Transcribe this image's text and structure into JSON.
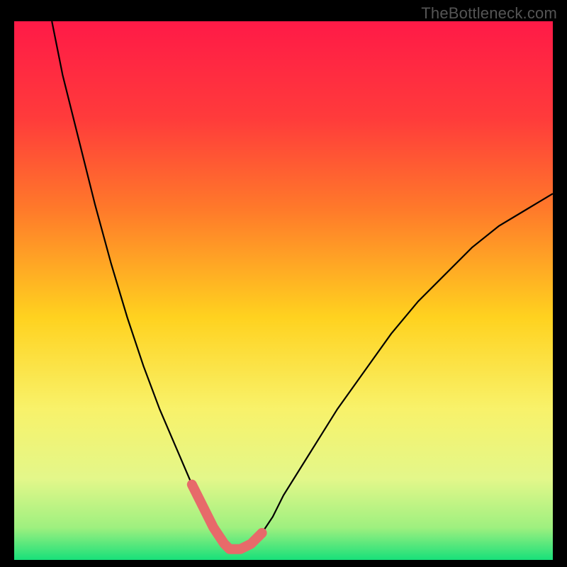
{
  "watermark": "TheBottleneck.com",
  "chart_data": {
    "type": "line",
    "title": "",
    "xlabel": "",
    "ylabel": "",
    "xlim": [
      0,
      100
    ],
    "ylim": [
      0,
      100
    ],
    "grid": false,
    "legend": false,
    "description": "Bottleneck-style V-curve over a red-to-green vertical gradient. Upper region is red (poor match), lower region is green (good match). The curve descends from the top-left, bottoms out near the lower third of the x-range, and rises again toward the right. The curve's trough is highlighted with a thicker salmon stroke.",
    "series": [
      {
        "name": "curve",
        "x": [
          7,
          9,
          12,
          15,
          18,
          21,
          24,
          27,
          30,
          33,
          35,
          37,
          39,
          40,
          42,
          44,
          46,
          48,
          50,
          55,
          60,
          65,
          70,
          75,
          80,
          85,
          90,
          95,
          100
        ],
        "y": [
          100,
          90,
          78,
          66,
          55,
          45,
          36,
          28,
          21,
          14,
          10,
          6,
          3,
          2,
          2,
          3,
          5,
          8,
          12,
          20,
          28,
          35,
          42,
          48,
          53,
          58,
          62,
          65,
          68
        ]
      }
    ],
    "trough_highlight": {
      "name": "trough",
      "x": [
        33,
        35,
        37,
        39,
        40,
        42,
        44,
        46
      ],
      "y": [
        14,
        10,
        6,
        3,
        2,
        2,
        3,
        5
      ]
    },
    "gradient_stops": [
      {
        "offset": 0,
        "color": "#ff1a47"
      },
      {
        "offset": 18,
        "color": "#ff3b3b"
      },
      {
        "offset": 35,
        "color": "#ff7a2a"
      },
      {
        "offset": 55,
        "color": "#ffd21f"
      },
      {
        "offset": 72,
        "color": "#f8f26a"
      },
      {
        "offset": 85,
        "color": "#e3f78a"
      },
      {
        "offset": 94,
        "color": "#9ef07f"
      },
      {
        "offset": 100,
        "color": "#18e07a"
      }
    ],
    "colors": {
      "curve_stroke": "#000000",
      "trough_stroke": "#e76a6a",
      "background": "#000000"
    }
  }
}
